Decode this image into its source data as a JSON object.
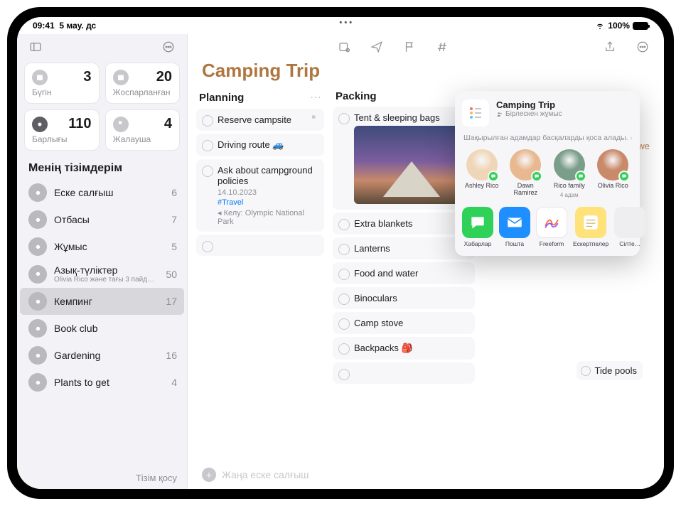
{
  "status": {
    "time": "09:41",
    "date": "5 мау. дс",
    "battery": "100%"
  },
  "sidebar": {
    "smart": [
      {
        "label": "Бүгін",
        "count": "3"
      },
      {
        "label": "Жоспарланған",
        "count": "20"
      },
      {
        "label": "Барлығы",
        "count": "110"
      },
      {
        "label": "Жалауша",
        "count": "4"
      }
    ],
    "listsHeader": "Менің тізімдерім",
    "lists": [
      {
        "name": "Еске салғыш",
        "count": "6",
        "color": "#b9b9be"
      },
      {
        "name": "Отбасы",
        "count": "7",
        "color": "#b9b9be"
      },
      {
        "name": "Жұмыс",
        "count": "5",
        "color": "#b9b9be"
      },
      {
        "name": "Азық-түліктер",
        "sub": "Olivia Rico және тағы 3 пайд…",
        "count": "50",
        "color": "#b9b9be"
      },
      {
        "name": "Кемпинг",
        "count": "17",
        "color": "#b9b9be",
        "selected": true
      },
      {
        "name": "Book club",
        "count": "",
        "color": "#b9b9be"
      },
      {
        "name": "Gardening",
        "count": "16",
        "color": "#b9b9be"
      },
      {
        "name": "Plants to get",
        "count": "4",
        "color": "#b9b9be"
      }
    ],
    "addList": "Тізім қосу"
  },
  "main": {
    "title": "Camping Trip",
    "newReminder": "Жаңа еске салғыш",
    "columns": {
      "planning": {
        "title": "Planning",
        "items": [
          {
            "text": "Reserve campsite",
            "flag": true
          },
          {
            "text": "Driving route 🚙"
          },
          {
            "text": "Ask about campground policies",
            "date": "14.10.2023",
            "tag": "#Travel",
            "loc": "◂ Келу: Olympic National Park"
          }
        ]
      },
      "packing": {
        "title": "Packing",
        "items": [
          {
            "text": "Tent & sleeping bags",
            "image": true
          },
          {
            "text": "Extra blankets"
          },
          {
            "text": "Lanterns"
          },
          {
            "text": "Food and water"
          },
          {
            "text": "Binoculars"
          },
          {
            "text": "Camp stove"
          },
          {
            "text": "Backpacks 🎒"
          }
        ]
      }
    },
    "peekText": "we",
    "peekItem": "Tide pools"
  },
  "share": {
    "title": "Camping Trip",
    "sub": "Бірлескен жұмыс",
    "invite": "Шақырылған адамдар басқаларды қоса алады.",
    "contacts": [
      {
        "name": "Ashley Rico",
        "bg": "#f0d6b8"
      },
      {
        "name": "Dawn Ramirez",
        "bg": "#e8b890"
      },
      {
        "name": "Rico family",
        "sub": "4 адам",
        "bg": "#7a9e8a"
      },
      {
        "name": "Olivia Rico",
        "bg": "#c98a6a"
      }
    ],
    "apps": [
      {
        "name": "Хабарлар",
        "bg": "#30d158"
      },
      {
        "name": "Пошта",
        "bg": "#1f8fff"
      },
      {
        "name": "Freeform",
        "bg": "#ffffff"
      },
      {
        "name": "Ескертпелер",
        "bg": "#ffe27a"
      },
      {
        "name": "Сілте…",
        "bg": "#eeeef0"
      }
    ]
  }
}
